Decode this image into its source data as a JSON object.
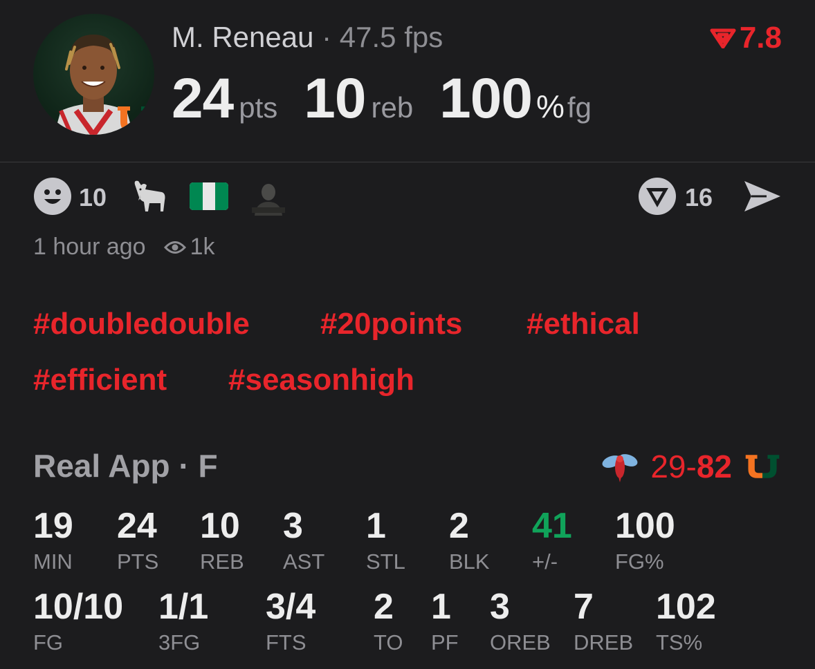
{
  "header": {
    "player_name": "M. Reneau",
    "separator": "·",
    "fps_label": "47.5 fps",
    "rating_value": "7.8",
    "rating_color": "#e8252b",
    "avatar_icon": "player-photo",
    "team_logo": "U"
  },
  "headline": {
    "pts_value": "24",
    "pts_unit": "pts",
    "reb_value": "10",
    "reb_unit": "reb",
    "fg_value": "100",
    "fg_pct": "%",
    "fg_unit": "fg"
  },
  "reactions": {
    "smiley_count": "10",
    "ring_count": "16",
    "icons": [
      "smiley-icon",
      "goat-icon",
      "nigeria-flag-icon",
      "user-thumb-icon",
      "ring-v-icon",
      "send-icon"
    ]
  },
  "meta": {
    "time_ago": "1 hour ago",
    "views": "1k"
  },
  "hashtags": [
    "#doubledouble",
    "#20points",
    "#ethical",
    "#efficient",
    "#seasonhigh"
  ],
  "game": {
    "app_label": "Real App · F",
    "opp_score": "29",
    "dash": "-",
    "own_score": "82",
    "team_logo": "U",
    "accent_green": "#10a35a",
    "accent_red": "#e8252b"
  },
  "stats_row1": [
    {
      "value": "19",
      "label": "MIN"
    },
    {
      "value": "24",
      "label": "PTS"
    },
    {
      "value": "10",
      "label": "REB"
    },
    {
      "value": "3",
      "label": "AST"
    },
    {
      "value": "1",
      "label": "STL"
    },
    {
      "value": "2",
      "label": "BLK"
    },
    {
      "value": "41",
      "label": "+/-"
    },
    {
      "value": "100",
      "label": "FG%"
    }
  ],
  "stats_row2": [
    {
      "value": "10/10",
      "label": "FG"
    },
    {
      "value": "1/1",
      "label": "3FG"
    },
    {
      "value": "3/4",
      "label": "FTS"
    },
    {
      "value": "2",
      "label": "TO"
    },
    {
      "value": "1",
      "label": "PF"
    },
    {
      "value": "3",
      "label": "OREB"
    },
    {
      "value": "7",
      "label": "DREB"
    },
    {
      "value": "102",
      "label": "TS%"
    }
  ]
}
